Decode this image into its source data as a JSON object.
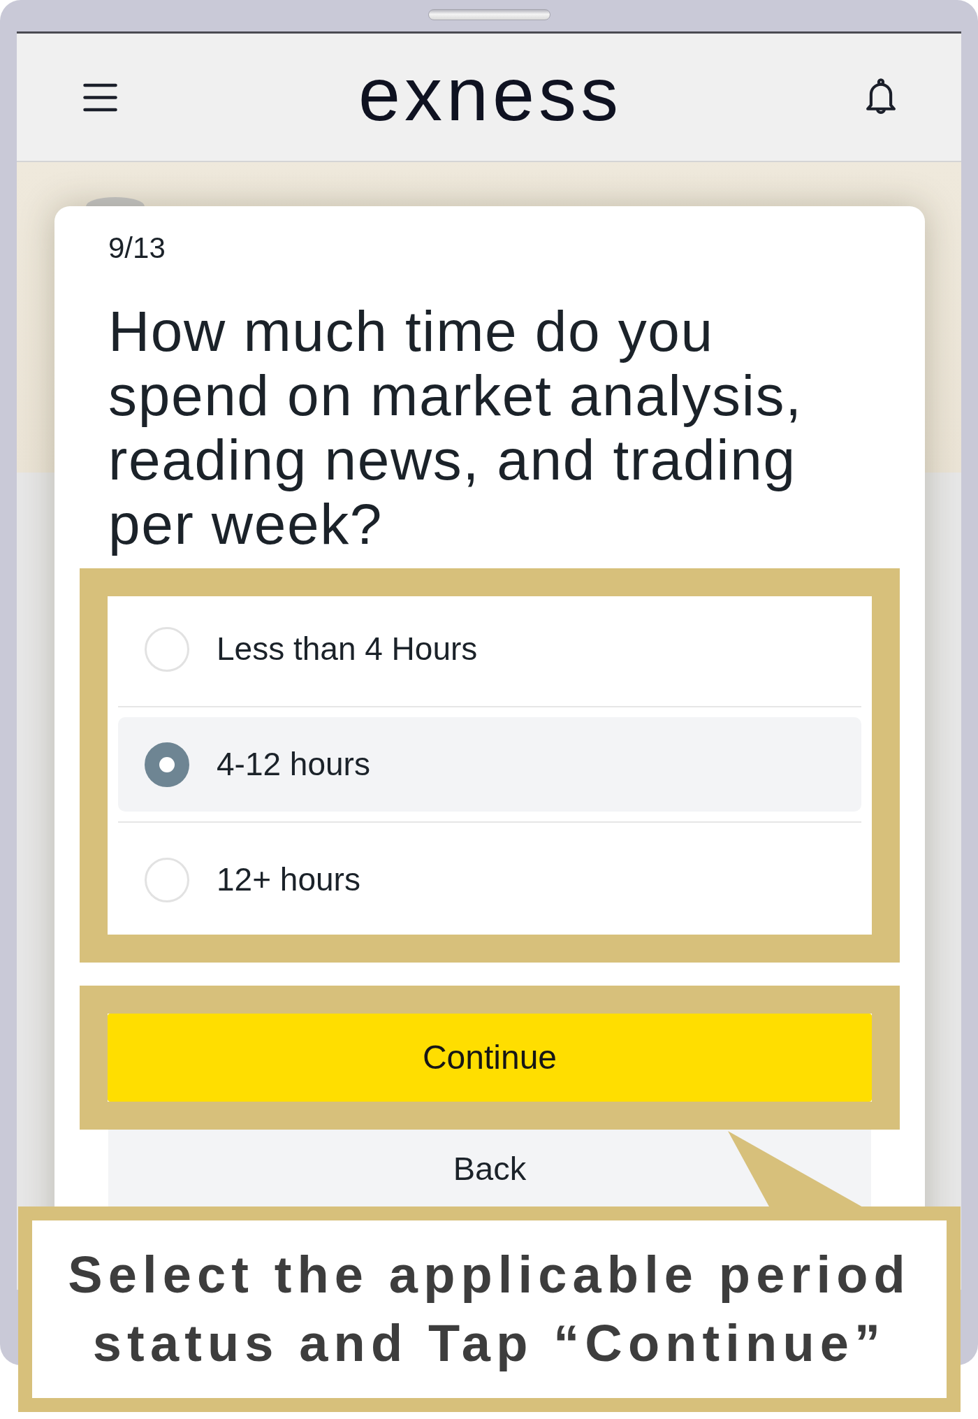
{
  "header": {
    "logo": "exness"
  },
  "question": {
    "counter": "9/13",
    "text": "How much time do you spend on market analysis, reading news, and trading per week?"
  },
  "answers": {
    "highlighted": true,
    "options": [
      {
        "label": "Less than 4 Hours",
        "selected": false
      },
      {
        "label": "4-12 hours",
        "selected": true
      },
      {
        "label": "12+ hours",
        "selected": false
      }
    ]
  },
  "buttons": [
    {
      "label": "Continue",
      "kind": "primary",
      "highlighted": true
    },
    {
      "label": "Back",
      "kind": "secondary",
      "highlighted": false
    }
  ],
  "callout": {
    "text": "Select the applicable period status and Tap “Continue”"
  }
}
